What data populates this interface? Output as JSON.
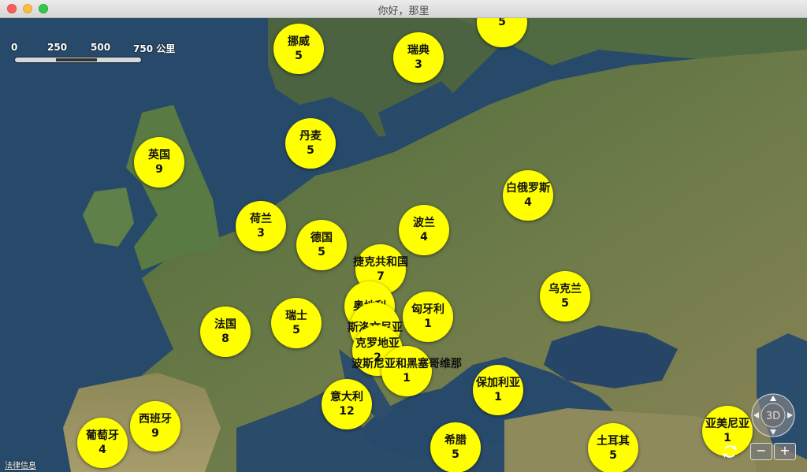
{
  "window": {
    "title": "你好，那里"
  },
  "scale": {
    "labels": [
      "0",
      "250",
      "500",
      "750 公里"
    ]
  },
  "legal": "法律信息",
  "compass": {
    "label": "3D"
  },
  "zoom": {
    "out": "−",
    "in": "+"
  },
  "markers": [
    {
      "name": "",
      "count": "5"
    },
    {
      "name": "挪威",
      "count": "5"
    },
    {
      "name": "瑞典",
      "count": "3"
    },
    {
      "name": "丹麦",
      "count": "5"
    },
    {
      "name": "英国",
      "count": "9"
    },
    {
      "name": "白俄罗斯",
      "count": "4"
    },
    {
      "name": "荷兰",
      "count": "3"
    },
    {
      "name": "波兰",
      "count": "4"
    },
    {
      "name": "德国",
      "count": "5"
    },
    {
      "name": "捷克共和国",
      "count": "7"
    },
    {
      "name": "乌克兰",
      "count": "5"
    },
    {
      "name": "奥地利",
      "count": ""
    },
    {
      "name": "匈牙利",
      "count": "1"
    },
    {
      "name": "瑞士",
      "count": "5"
    },
    {
      "name": "法国",
      "count": "8"
    },
    {
      "name": "斯洛文尼亚",
      "count": ""
    },
    {
      "name": "克罗地亚",
      "count": "2"
    },
    {
      "name": "波斯尼亚和黑塞哥维那",
      "count": "1"
    },
    {
      "name": "保加利亚",
      "count": "1"
    },
    {
      "name": "意大利",
      "count": "12"
    },
    {
      "name": "西班牙",
      "count": "9"
    },
    {
      "name": "葡萄牙",
      "count": "4"
    },
    {
      "name": "希腊",
      "count": "5"
    },
    {
      "name": "土耳其",
      "count": "5"
    },
    {
      "name": "亚美尼亚",
      "count": "1"
    }
  ]
}
